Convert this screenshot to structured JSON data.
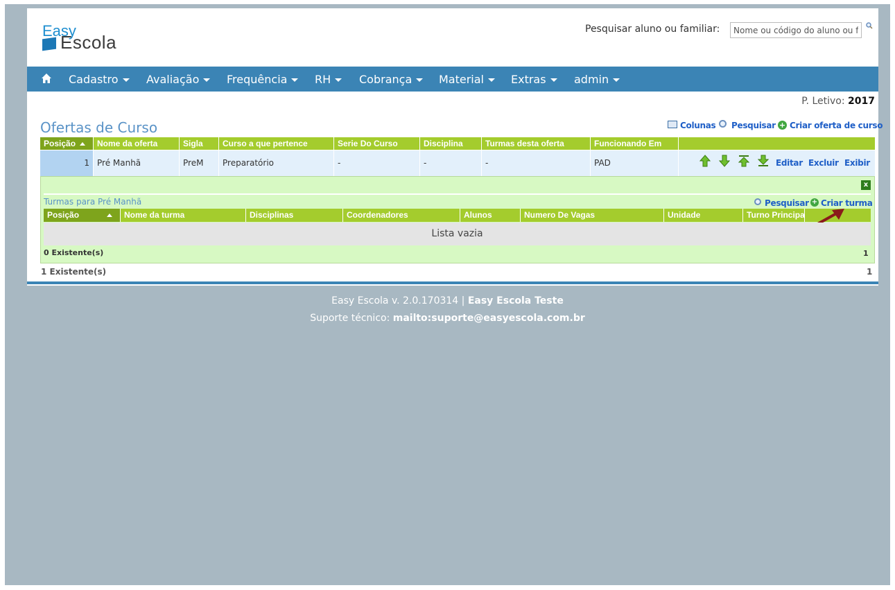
{
  "header": {
    "logo_line1": "Easy",
    "logo_line2": "Escola",
    "search_label": "Pesquisar aluno ou familiar:",
    "search_placeholder": "Nome ou código do aluno ou fa"
  },
  "nav": {
    "items": [
      "Cadastro",
      "Avaliação",
      "Frequência",
      "RH",
      "Cobrança",
      "Material",
      "Extras",
      "admin"
    ],
    "color": "#3b84b5"
  },
  "period": {
    "label": "P. Letivo:",
    "value": "2017"
  },
  "page_title": "Ofertas de Curso",
  "toolbar": {
    "columns": "Colunas",
    "search": "Pesquisar",
    "create": "Criar oferta de curso"
  },
  "table": {
    "headers": [
      "Posição",
      "Nome da oferta",
      "Sigla",
      "Curso a que pertence",
      "Serie Do Curso",
      "Disciplina",
      "Turmas desta oferta",
      "Funcionando Em"
    ],
    "row": [
      "1",
      "Pré Manhã",
      "PreM",
      "Preparatório",
      "-",
      "-",
      "-",
      "PAD"
    ],
    "actions": [
      "Editar",
      "Excluir",
      "Exibir"
    ]
  },
  "nested": {
    "title": "Turmas para Pré Manhã",
    "search": "Pesquisar",
    "create": "Criar turma",
    "close": "x",
    "headers": [
      "Posição",
      "Nome da turma",
      "Disciplinas",
      "Coordenadores",
      "Alunos",
      "Numero De Vagas",
      "Unidade",
      "Turno Principal"
    ],
    "empty": "Lista vazia",
    "count": "0 Existente(s)",
    "page": "1"
  },
  "main_count": "1 Existente(s)",
  "main_page": "1",
  "footer": {
    "version_text": "Easy Escola v. 2.0.170314 |",
    "school": "Easy Escola Teste",
    "support_label": "Suporte técnico:",
    "support_email": "mailto:suporte@easyescola.com.br"
  },
  "colors": {
    "accent": "#a4cc2d",
    "title": "#5a93c7",
    "link": "#1f5fc7",
    "background": "#a8b8c2"
  }
}
